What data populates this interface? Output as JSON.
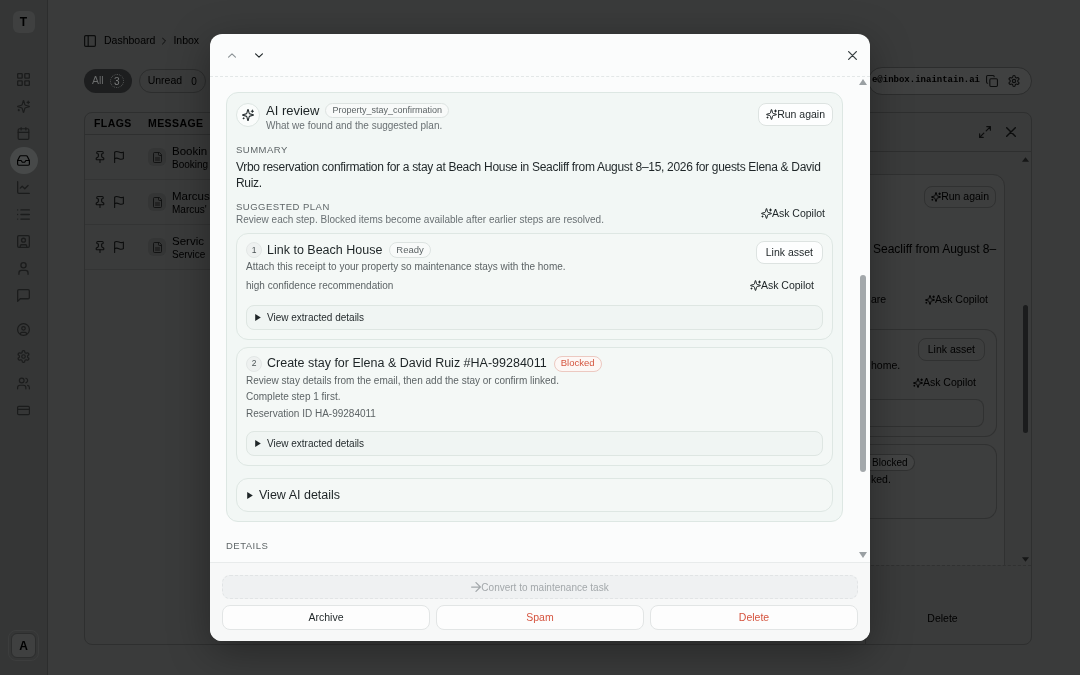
{
  "sidebar": {
    "logo": "T",
    "nav_sections": [
      {
        "items": [
          {
            "selected": false
          },
          {
            "selected": false
          },
          {
            "selected": false
          },
          {
            "selected": true
          },
          {
            "selected": false
          },
          {
            "selected": false
          },
          {
            "selected": false
          },
          {
            "selected": false
          },
          {
            "selected": false
          }
        ]
      },
      {
        "items": [
          {
            "selected": false
          },
          {
            "selected": false
          },
          {
            "selected": false
          },
          {
            "selected": false
          }
        ]
      }
    ],
    "avatar": "A"
  },
  "breadcrumb": [
    "Dashboard",
    "Inbox"
  ],
  "filter_tabs": [
    {
      "label": "All",
      "count": "3",
      "selected": true
    },
    {
      "label": "Unread",
      "count": "0",
      "selected": false
    }
  ],
  "inbox_address": "e@inbox.inaintain.ai",
  "message_list": {
    "columns": [
      "FLAGS",
      "MESSAGE"
    ],
    "rows": [
      {
        "title": "Bookin",
        "subtitle": "Booking"
      },
      {
        "title": "Marcus",
        "subtitle": "Marcus'"
      },
      {
        "title": "Servic",
        "subtitle": "Service"
      }
    ]
  },
  "detail_panel": {
    "run_again": "Run again",
    "summary_fragment": "Seacliff from August 8–",
    "plan_fragment": "are",
    "ask_copilot": "Ask Copilot",
    "step_1": {
      "action": "Link asset",
      "description_fragment": "home.",
      "ask_copilot": "Ask Copilot"
    },
    "step_2": {
      "status": "Blocked",
      "description_fragment": "ked."
    },
    "delete": "Delete"
  },
  "modal": {
    "ai_review": {
      "title": "AI review",
      "category": "Property_stay_confirmation",
      "subtitle": "What we found and the suggested plan.",
      "run_again": "Run again",
      "summary_label": "SUMMARY",
      "summary": "Vrbo reservation confirmation for a stay at Beach House in Seacliff from August 8–15, 2026 for guests Elena & David Ruiz.",
      "plan_label": "SUGGESTED PLAN",
      "plan_note": "Review each step. Blocked items become available after earlier steps are resolved.",
      "ask_copilot": "Ask Copilot",
      "steps": [
        {
          "number": "1",
          "title": "Link to Beach House",
          "status": {
            "label": "Ready",
            "kind": "ready"
          },
          "action": "Link asset",
          "lines": [
            "Attach this receipt to your property so maintenance stays with the home."
          ],
          "note": "high confidence recommendation",
          "ask_copilot": "Ask Copilot",
          "disclosure": {
            "label": "View extracted details",
            "expanded": false
          }
        },
        {
          "number": "2",
          "title": "Create stay for Elena & David Ruiz #HA-99284011",
          "status": {
            "label": "Blocked",
            "kind": "blocked"
          },
          "lines": [
            "Review stay details from the email, then add the stay or confirm linked.",
            "Complete step 1 first.",
            "Reservation ID HA-99284011"
          ],
          "disclosure": {
            "label": "View extracted details",
            "expanded": false
          }
        }
      ],
      "ai_details": {
        "label": "View AI details",
        "expanded": false
      }
    },
    "details_label": "DETAILS",
    "footer": {
      "convert": {
        "label": "Convert to maintenance task",
        "disabled": true
      },
      "actions": [
        {
          "label": "Archive",
          "kind": "neutral"
        },
        {
          "label": "Spam",
          "kind": "danger"
        },
        {
          "label": "Delete",
          "kind": "danger"
        }
      ]
    }
  }
}
